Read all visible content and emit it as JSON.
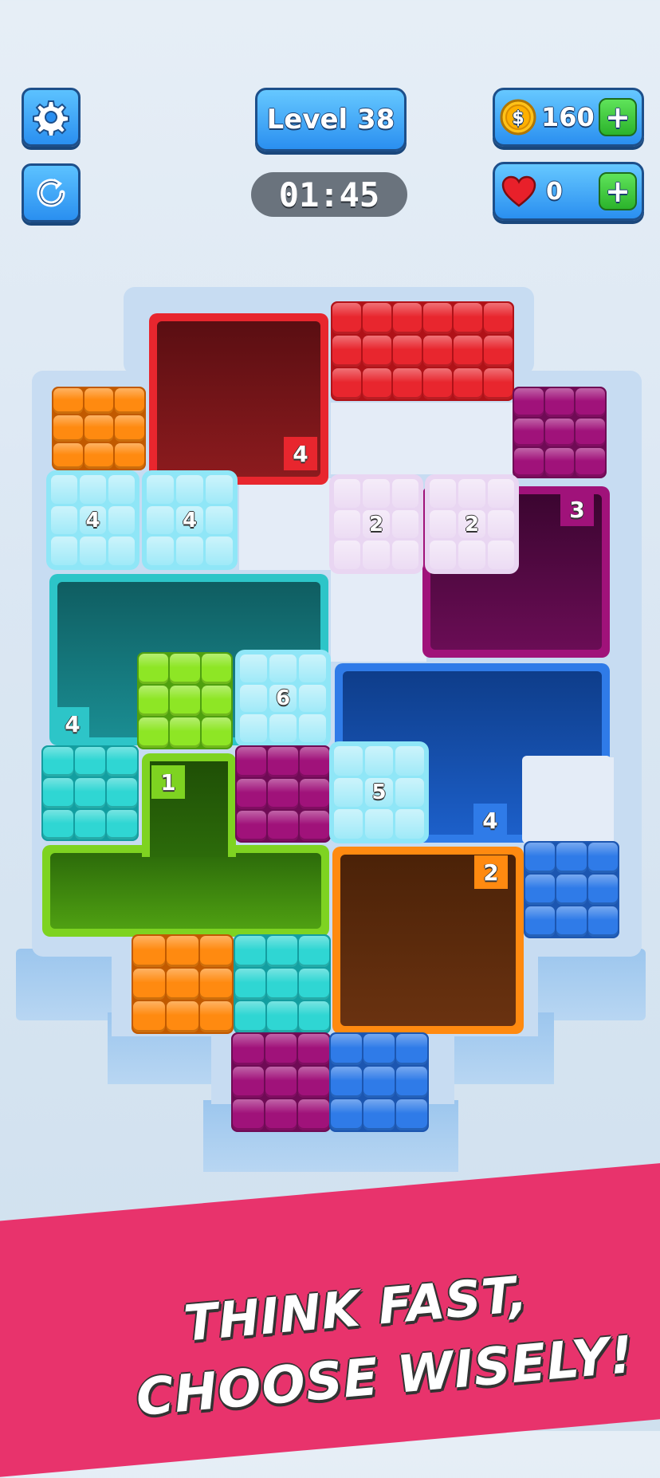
{
  "hud": {
    "level_label": "Level 38",
    "timer": "01:45",
    "coins": "160",
    "lives": "0",
    "icons": {
      "settings": "gear-icon",
      "restart": "restart-icon",
      "coin": "coin-icon",
      "heart": "heart-icon",
      "plus": "plus-icon"
    }
  },
  "board": {
    "counts": {
      "red_hole": "4",
      "purple_hole": "3",
      "teal_hole": "4",
      "green_hole": "1",
      "blue_hole": "4",
      "orange_hole": "2",
      "ice_a": "4",
      "ice_b": "4",
      "ice_c": "2",
      "ice_d": "2",
      "ice_e": "6",
      "ice_f": "5"
    },
    "colors": {
      "red": "#e8262e",
      "orange": "#ff8a10",
      "purple": "#a0127a",
      "cyan": "#2fd6d3",
      "lime": "#8ee625",
      "blue": "#2f7be8",
      "ice": "#8fe6f7",
      "ice_pink": "#e9d6f2"
    }
  },
  "banner": {
    "line1": "THINK FAST,",
    "line2": "CHOOSE WISELY!",
    "color": "#e8336c"
  }
}
